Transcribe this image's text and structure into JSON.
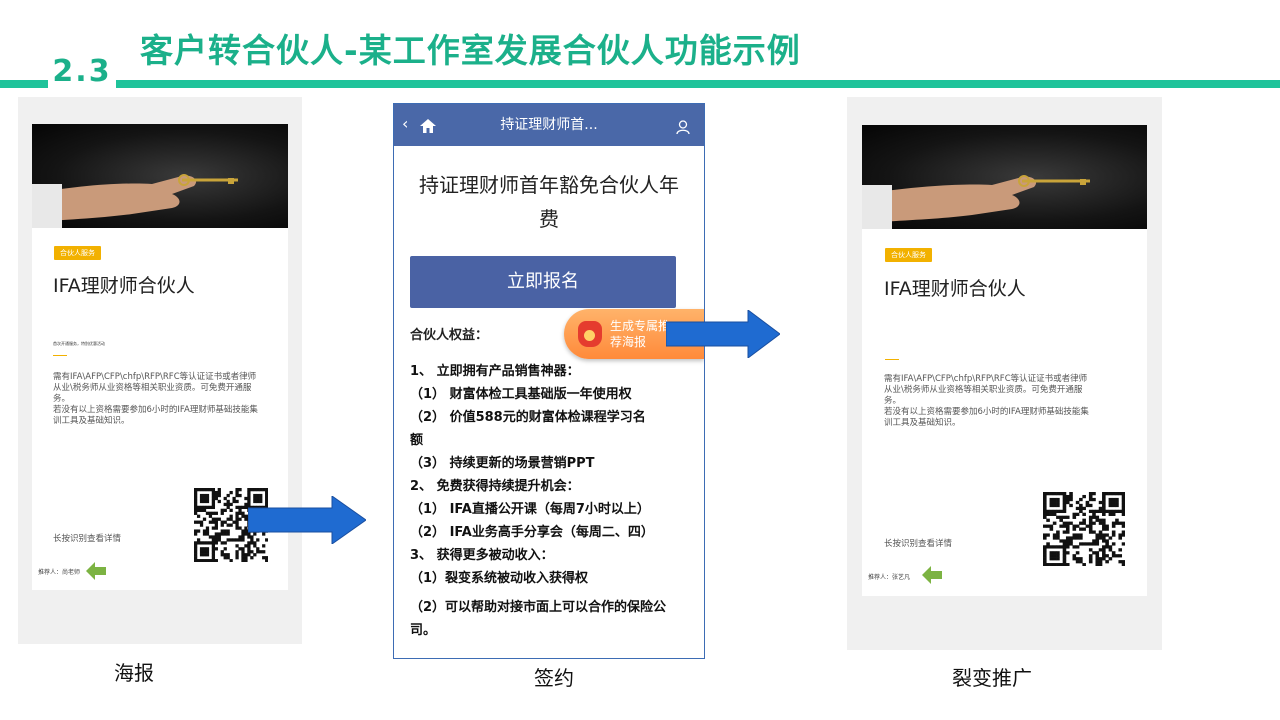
{
  "slide": {
    "section_number": "2.3",
    "title": "客户转合伙人-某工作室发展合伙人功能示例",
    "accent_color": "#1fc39a"
  },
  "poster_left": {
    "tag": "合伙人服务",
    "title": "IFA理财师合伙人",
    "small_line": "首次开通服务，特别优惠活动",
    "description_lines": [
      "需有IFA\\AFP\\CFP\\chfp\\RFP\\RFC等认证证书或者律师",
      "从业\\税务师从业资格等相关职业资质。可免费开通服",
      "务。",
      "若没有以上资格需要参加6小时的IFA理财师基础技能集",
      "训工具及基础知识。"
    ],
    "long_press": "长按识别查看详情",
    "referrer": "推荐人：尚老师",
    "caption": "海报"
  },
  "phone_mid": {
    "nav_title": "持证理财师首...",
    "doc_title": "持证理财师首年豁免合伙人年费",
    "cta_label": "立即报名",
    "benefits_title": "合伙人权益：",
    "poster_button": "生成专属推荐海报",
    "bullets": [
      "1、  立即拥有产品销售神器：",
      " （1）        财富体检工具基础版一年使用权",
      " （2）        价值588元的财富体检课程学习名",
      "额",
      " （3）        持续更新的场景营销PPT",
      "2、  免费获得持续提升机会：",
      " （1）        IFA直播公开课（每周7小时以上）",
      " （2）        IFA业务高手分享会（每周二、四）",
      "3、  获得更多被动收入：",
      " （1）裂变系统被动收入获得权",
      " （2）可以帮助对接市面上可以合作的保险公",
      "司。"
    ],
    "caption": "签约"
  },
  "poster_right": {
    "tag": "合伙人服务",
    "title": "IFA理财师合伙人",
    "description_lines": [
      "需有IFA\\AFP\\CFP\\chfp\\RFP\\RFC等认证证书或者律师",
      "从业\\税务师从业资格等相关职业资质。可免费开通服",
      "务。",
      "若没有以上资格需要参加6小时的IFA理财师基础技能集",
      "训工具及基础知识。"
    ],
    "long_press": "长按识别查看详情",
    "referrer": "推荐人：张艺凡",
    "caption": "裂变推广"
  }
}
